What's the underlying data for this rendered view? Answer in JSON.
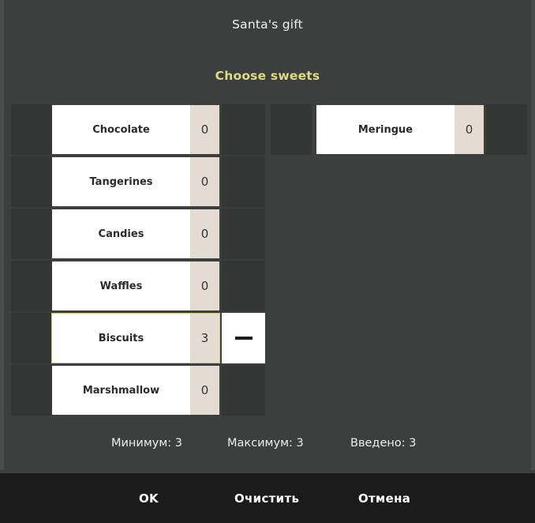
{
  "dialog": {
    "title": "Santa's gift",
    "subtitle": "Choose sweets"
  },
  "columns": {
    "left": [
      {
        "label": "Chocolate",
        "count": "0",
        "selected": false,
        "has_minus": false
      },
      {
        "label": "Tangerines",
        "count": "0",
        "selected": false,
        "has_minus": false
      },
      {
        "label": "Candies",
        "count": "0",
        "selected": false,
        "has_minus": false
      },
      {
        "label": "Waffles",
        "count": "0",
        "selected": false,
        "has_minus": false
      },
      {
        "label": "Biscuits",
        "count": "3",
        "selected": true,
        "has_minus": true
      },
      {
        "label": "Marshmallow",
        "count": "0",
        "selected": false,
        "has_minus": false
      }
    ],
    "right": [
      {
        "label": "Meringue",
        "count": "0",
        "selected": false,
        "has_minus": false
      }
    ]
  },
  "status": [
    "Минимум: 3",
    "Максимум: 3",
    "Введено: 3"
  ],
  "buttons": [
    "OK",
    "Очистить",
    "Отмена"
  ],
  "icons": {
    "minus": "minus-icon"
  },
  "colors": {
    "dialog_background": "#3d3f3e",
    "cell_background": "#333635",
    "item_background": "#ffffff",
    "count_background": "#e4dcd3",
    "selected_border": "#c8c87e",
    "subtitle_text": "#dcdc82",
    "title_text": "#f2f2f2",
    "buttonbar_background": "#1b1b1b",
    "button_text": "#ffffff"
  }
}
